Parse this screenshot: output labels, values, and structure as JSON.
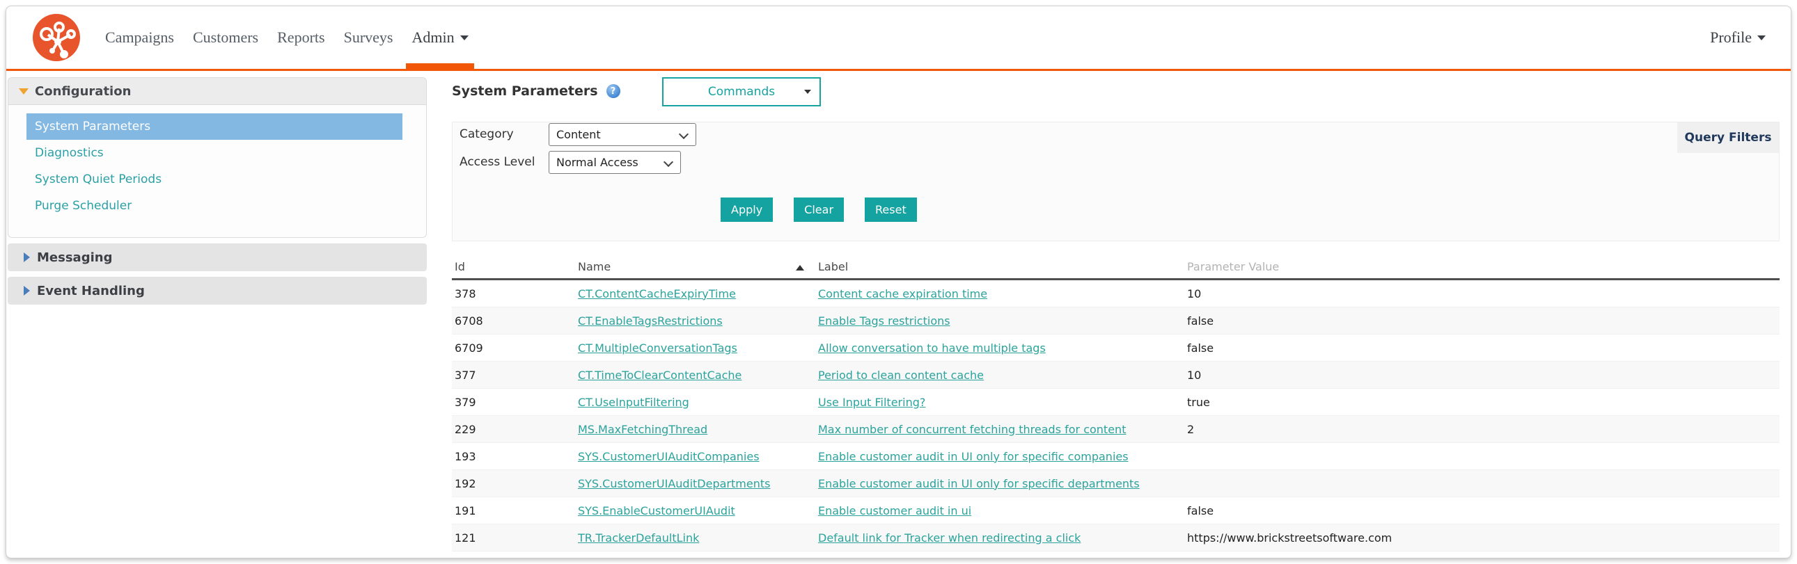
{
  "colors": {
    "accent_orange": "#f25607",
    "logo_orange": "#e8542b",
    "button_teal": "#14a3a0",
    "link_teal": "#2ba39c",
    "selected_item_blue": "#82b8e2",
    "query_tab_text": "#20395c"
  },
  "nav": {
    "items": [
      {
        "label": "Campaigns",
        "active": false,
        "has_caret": false
      },
      {
        "label": "Customers",
        "active": false,
        "has_caret": false
      },
      {
        "label": "Reports",
        "active": false,
        "has_caret": false
      },
      {
        "label": "Surveys",
        "active": false,
        "has_caret": false
      },
      {
        "label": "Admin",
        "active": true,
        "has_caret": true
      }
    ],
    "profile": {
      "label": "Profile",
      "has_caret": true
    }
  },
  "sidebar": {
    "sections": [
      {
        "label": "Configuration",
        "expanded": true,
        "items": [
          {
            "label": "System Parameters",
            "selected": true
          },
          {
            "label": "Diagnostics",
            "selected": false
          },
          {
            "label": "System Quiet Periods",
            "selected": false
          },
          {
            "label": "Purge Scheduler",
            "selected": false
          }
        ]
      },
      {
        "label": "Messaging",
        "expanded": false
      },
      {
        "label": "Event Handling",
        "expanded": false
      }
    ]
  },
  "main": {
    "title": "System Parameters",
    "help_icon": "question-mark-icon",
    "commands_dropdown": {
      "value": "Commands"
    },
    "filters": {
      "tab_label": "Query Filters",
      "fields": [
        {
          "label": "Category",
          "value": "Content"
        },
        {
          "label": "Access Level",
          "value": "Normal Access"
        }
      ],
      "buttons": [
        "Apply",
        "Clear",
        "Reset"
      ]
    },
    "table": {
      "columns": [
        "Id",
        "Name",
        "Label",
        "Parameter Value"
      ],
      "sorted_column": "Name",
      "sort_direction": "asc",
      "rows": [
        {
          "id": "378",
          "name": "CT.ContentCacheExpiryTime",
          "label": "Content cache expiration time",
          "value": "10"
        },
        {
          "id": "6708",
          "name": "CT.EnableTagsRestrictions",
          "label": "Enable Tags restrictions",
          "value": "false"
        },
        {
          "id": "6709",
          "name": "CT.MultipleConversationTags",
          "label": "Allow conversation to have multiple tags",
          "value": "false"
        },
        {
          "id": "377",
          "name": "CT.TimeToClearContentCache",
          "label": "Period to clean content cache",
          "value": "10"
        },
        {
          "id": "379",
          "name": "CT.UseInputFiltering",
          "label": "Use Input Filtering?",
          "value": "true"
        },
        {
          "id": "229",
          "name": "MS.MaxFetchingThread",
          "label": "Max number of concurrent fetching threads for content",
          "value": "2"
        },
        {
          "id": "193",
          "name": "SYS.CustomerUIAuditCompanies",
          "label": "Enable customer audit in UI only for specific companies",
          "value": ""
        },
        {
          "id": "192",
          "name": "SYS.CustomerUIAuditDepartments",
          "label": "Enable customer audit in UI only for specific departments",
          "value": ""
        },
        {
          "id": "191",
          "name": "SYS.EnableCustomerUIAudit",
          "label": "Enable customer audit in ui",
          "value": "false"
        },
        {
          "id": "121",
          "name": "TR.TrackerDefaultLink",
          "label": "Default link for Tracker when redirecting a click",
          "value": "https://www.brickstreetsoftware.com"
        }
      ]
    }
  }
}
